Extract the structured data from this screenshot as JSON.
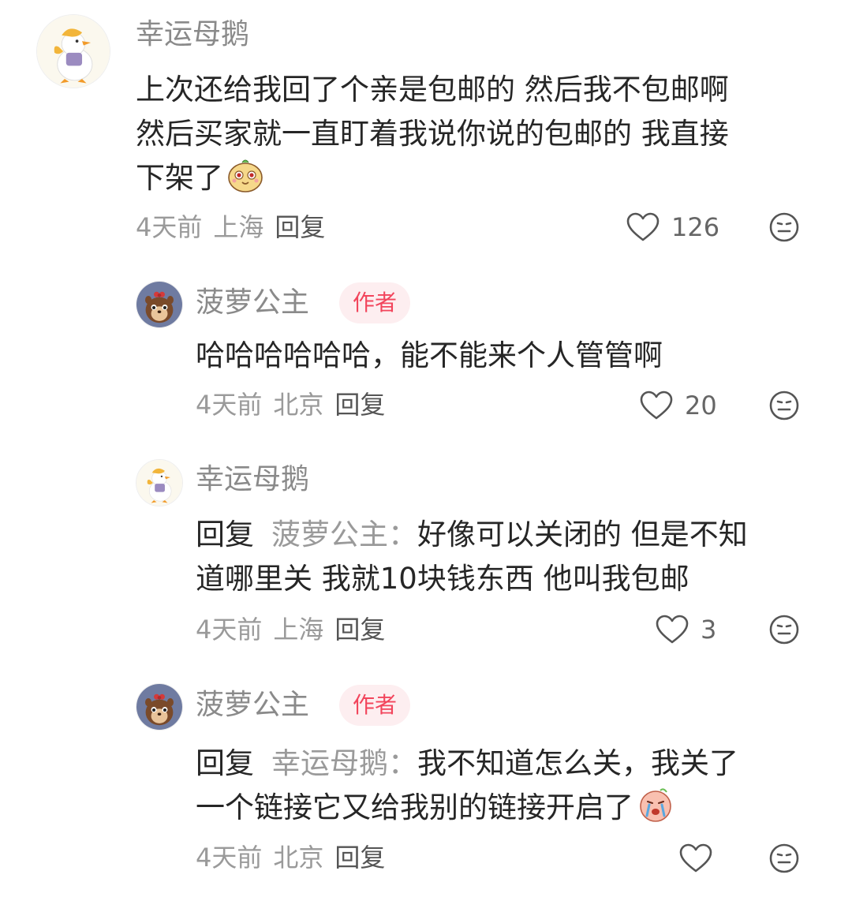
{
  "comments": [
    {
      "user": "幸运母鹅",
      "lines": [
        "上次还给我回了个亲是包邮的 然后我不包邮啊",
        "然后买家就一直盯着我说你说的包邮的 我直接",
        "下架了"
      ],
      "time": "4天前",
      "location": "上海",
      "reply_label": "回复",
      "likes": "126"
    },
    {
      "user": "菠萝公主",
      "badge": "作者",
      "lines": [
        "哈哈哈哈哈哈，能不能来个人管管啊"
      ],
      "time": "4天前",
      "location": "北京",
      "reply_label": "回复",
      "likes": "20"
    },
    {
      "user": "幸运母鹅",
      "reply_prefix": "回复",
      "reply_to": "菠萝公主：",
      "lines": [
        "好像可以关闭的 但是不知",
        "道哪里关 我就10块钱东西 他叫我包邮"
      ],
      "time": "4天前",
      "location": "上海",
      "reply_label": "回复",
      "likes": "3"
    },
    {
      "user": "菠萝公主",
      "badge": "作者",
      "reply_prefix": "回复",
      "reply_to": "幸运母鹅：",
      "lines": [
        "我不知道怎么关，我关了",
        "一个链接它又给我别的链接开启了"
      ],
      "time": "4天前",
      "location": "北京",
      "reply_label": "回复",
      "likes": ""
    }
  ],
  "colors": {
    "author_badge_text": "#f2455c",
    "author_badge_bg": "#fdeef0",
    "username": "#8a8a8a"
  },
  "icons": [
    "goose-avatar",
    "chipmunk-avatar",
    "heart-icon",
    "dislike-face-icon",
    "potato-emoji",
    "crying-emoji"
  ]
}
